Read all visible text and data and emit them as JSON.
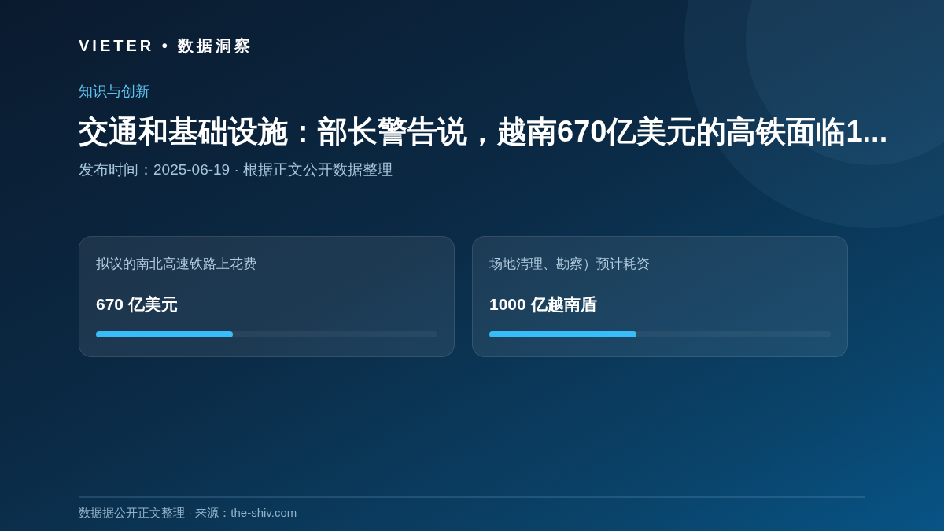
{
  "brand": "VIETER • 数据洞察",
  "article": {
    "category": "知识与创新",
    "title": "交通和基础设施：部长警告说，越南670亿美元的高铁面临1...",
    "meta": "发布时间：2025-06-19 · 根据正文公开数据整理"
  },
  "stats": [
    {
      "label": "拟议的南北高速铁路上花费",
      "value": "670 亿美元",
      "level": 0.4
    },
    {
      "label": "场地清理、勘察）预计耗资",
      "value": "1000 亿越南盾",
      "level": 0.43
    }
  ],
  "footer": "数据据公开正文整理 · 来源：the-shiv.com"
}
